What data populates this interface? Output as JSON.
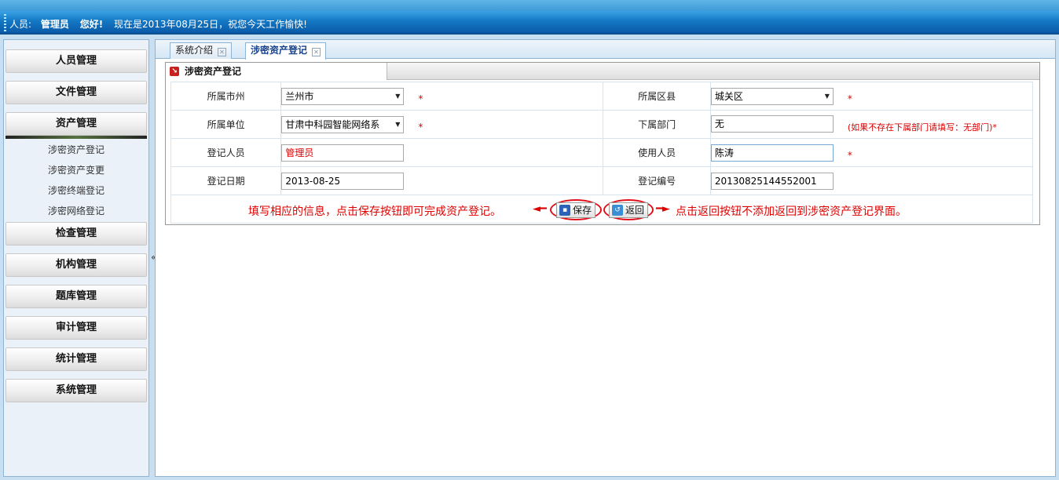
{
  "header": {
    "user_label": "人员:",
    "user_name": "管理员",
    "greeting": "您好!",
    "date_text": "现在是2013年08月25日，祝您今天工作愉快!"
  },
  "sidebar": {
    "menus": [
      {
        "label": "人员管理"
      },
      {
        "label": "文件管理"
      },
      {
        "label": "资产管理"
      },
      {
        "label": "检查管理"
      },
      {
        "label": "机构管理"
      },
      {
        "label": "题库管理"
      },
      {
        "label": "审计管理"
      },
      {
        "label": "统计管理"
      },
      {
        "label": "系统管理"
      }
    ],
    "submenu": [
      "涉密资产登记",
      "涉密资产变更",
      "涉密终端登记",
      "涉密网络登记"
    ],
    "collapse": "«"
  },
  "tabs": [
    {
      "label": "系统介绍",
      "close": "⊠"
    },
    {
      "label": "涉密资产登记",
      "close": "⊠"
    }
  ],
  "form": {
    "title": "涉密资产登记",
    "city_label": "所属市州",
    "city_value": "兰州市",
    "district_label": "所属区县",
    "district_value": "城关区",
    "unit_label": "所属单位",
    "unit_value": "甘肃中科园智能网络系",
    "subdept_label": "下属部门",
    "subdept_value": "无",
    "subdept_hint": "(如果不存在下属部门请填写：无部门)*",
    "registrar_label": "登记人员",
    "registrar_value": "管理员",
    "user_label": "使用人员",
    "user_value": "陈涛",
    "date_label": "登记日期",
    "date_value": "2013-08-25",
    "number_label": "登记编号",
    "number_value": "20130825144552001",
    "required_mark": "*",
    "save_label": "保存",
    "back_label": "返回",
    "instruction_left": "填写相应的信息，点击保存按钮即可完成资产登记。",
    "instruction_right": "点击返回按钮不添加返回到涉密资产登记界面。"
  }
}
